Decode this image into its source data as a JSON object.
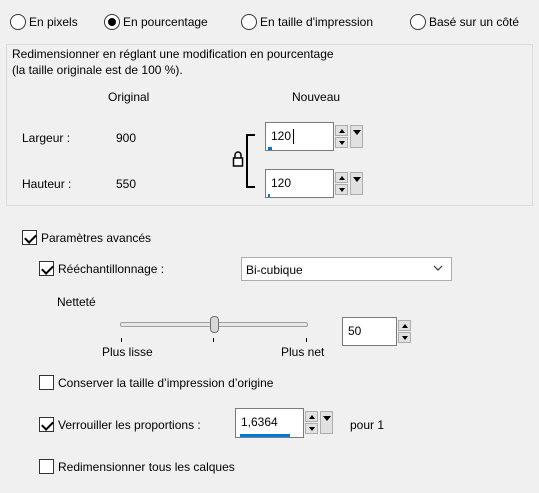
{
  "mode_options": [
    {
      "label": "En pixels",
      "selected": false
    },
    {
      "label": "En pourcentage",
      "selected": true
    },
    {
      "label": "En taille d'impression",
      "selected": false
    },
    {
      "label": "Basé sur un côté",
      "selected": false
    }
  ],
  "percent_group": {
    "title_line1": "Redimensionner en réglant une modification en pourcentage",
    "title_line2": "(la taille originale est de 100 %).",
    "col_original": "Original",
    "col_new": "Nouveau",
    "width_label": "Largeur :",
    "width_original": "900",
    "width_new": "120",
    "height_label": "Hauteur :",
    "height_original": "550",
    "height_new": "120",
    "lock_linked": true
  },
  "advanced": {
    "label": "Paramètres avancés",
    "checked": true,
    "resample": {
      "label": "Rééchantillonnage :",
      "checked": true,
      "method": "Bi-cubique"
    },
    "sharpness": {
      "label": "Netteté",
      "min_label": "Plus lisse",
      "max_label": "Plus net",
      "value": "50",
      "level": 0.5
    },
    "keep_print_size": {
      "label": "Conserver la taille d’impression d’origine",
      "checked": false
    },
    "lock_ratio": {
      "label": "Verrouiller les proportions :",
      "checked": true,
      "value": "1,6364",
      "suffix": "pour 1"
    },
    "resize_layers": {
      "label": "Redimensionner tous les calques",
      "checked": false
    }
  },
  "colors": {
    "background": "#f0f0f0",
    "accent": "#0078d7",
    "border": "#dcdcdc"
  }
}
